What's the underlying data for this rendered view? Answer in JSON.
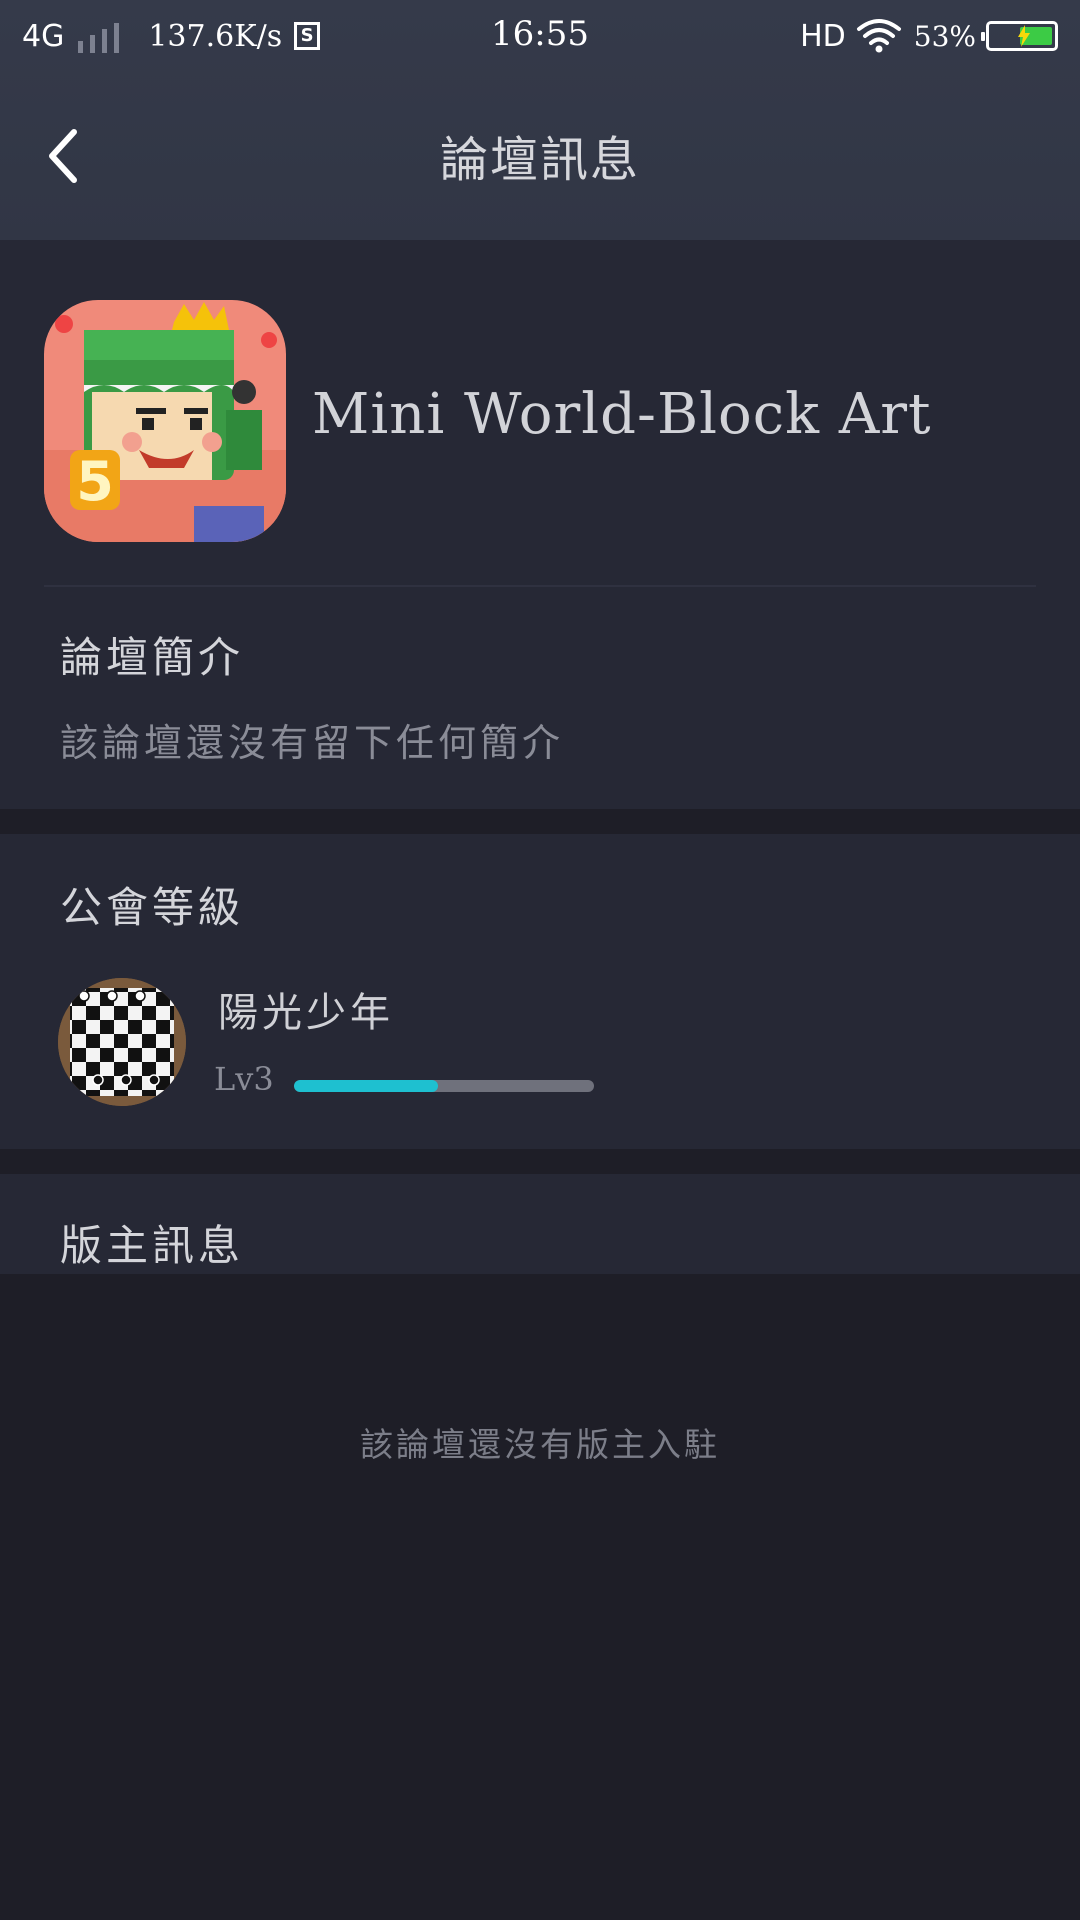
{
  "status_bar": {
    "network": "4G",
    "speed": "137.6K/s",
    "time": "16:55",
    "hd": "HD",
    "battery_percent": "53%",
    "battery_level": 0.53
  },
  "header": {
    "title": "論壇訊息"
  },
  "app": {
    "name": "Mini World-Block Art"
  },
  "intro": {
    "title": "論壇簡介",
    "text": "該論壇還沒有留下任何簡介"
  },
  "guild": {
    "title": "公會等級",
    "name": "陽光少年",
    "level": "Lv3",
    "progress": 0.48
  },
  "moderators": {
    "title": "版主訊息",
    "empty_text": "該論壇還沒有版主入駐"
  },
  "colors": {
    "accent": "#1ec0d0",
    "background": "#1e1e27",
    "card": "#262835",
    "header": "#353a4a"
  }
}
